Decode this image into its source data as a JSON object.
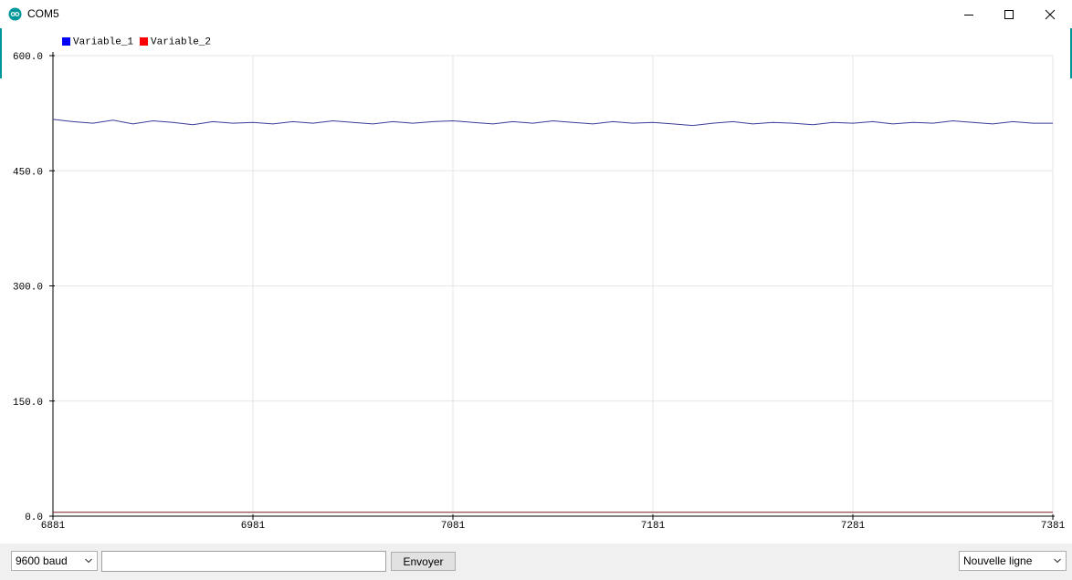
{
  "window": {
    "title": "COM5",
    "icon": "arduino-icon",
    "controls": [
      "minimize-icon",
      "maximize-icon",
      "close-icon"
    ]
  },
  "chart_data": {
    "type": "line",
    "title": "",
    "xlabel": "",
    "ylabel": "",
    "xlim": [
      6881,
      7381
    ],
    "ylim": [
      0,
      600
    ],
    "grid": true,
    "legend_position": "top-left",
    "x_ticks": [
      "6881",
      "6981",
      "7081",
      "7181",
      "7281",
      "7381"
    ],
    "y_ticks": [
      "0.0",
      "150.0",
      "300.0",
      "450.0",
      "600.0"
    ],
    "series": [
      {
        "name": "Variable_1",
        "color": "#0000ff",
        "line_color": "#3b3b9a",
        "x": [
          6881,
          6891,
          6901,
          6911,
          6921,
          6931,
          6941,
          6951,
          6961,
          6971,
          6981,
          6991,
          7001,
          7011,
          7021,
          7031,
          7041,
          7051,
          7061,
          7071,
          7081,
          7091,
          7101,
          7111,
          7121,
          7131,
          7141,
          7151,
          7161,
          7171,
          7181,
          7191,
          7201,
          7211,
          7221,
          7231,
          7241,
          7251,
          7261,
          7271,
          7281,
          7291,
          7301,
          7311,
          7321,
          7331,
          7341,
          7351,
          7361,
          7371,
          7381
        ],
        "y": [
          517,
          514,
          512,
          516,
          511,
          515,
          513,
          510,
          514,
          512,
          513,
          511,
          514,
          512,
          515,
          513,
          511,
          514,
          512,
          514,
          515,
          513,
          511,
          514,
          512,
          515,
          513,
          511,
          514,
          512,
          513,
          511,
          509,
          512,
          514,
          511,
          513,
          512,
          510,
          513,
          512,
          514,
          511,
          513,
          512,
          515,
          513,
          511,
          514,
          512,
          512
        ]
      },
      {
        "name": "Variable_2",
        "color": "#ff0000",
        "line_color": "#7a2020",
        "x": [
          6881,
          7381
        ],
        "y": [
          5,
          5
        ]
      }
    ]
  },
  "controls": {
    "baud_rate": "9600 baud",
    "input_value": "",
    "send_label": "Envoyer",
    "line_ending": "Nouvelle ligne"
  }
}
